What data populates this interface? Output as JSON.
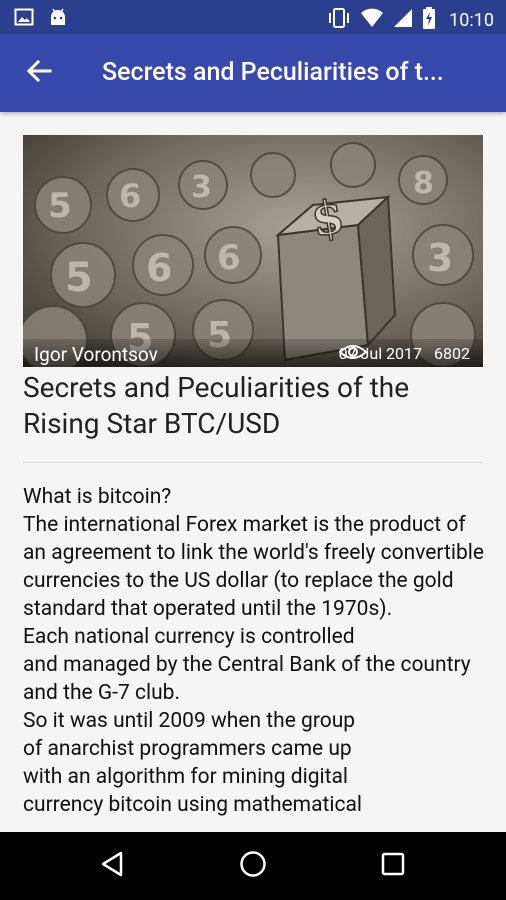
{
  "status_bar": {
    "time": "10:10"
  },
  "app_bar": {
    "title": "Secrets and Peculiarities of t..."
  },
  "article": {
    "author": "Igor Vorontsov",
    "date": "07 Jul 2017",
    "views": "6802",
    "title": "Secrets and Peculiarities of the Rising Star BTC/USD",
    "body": "What is bitcoin?\n  The international Forex market is the product of an agreement to link the world's freely convertible currencies to the US dollar (to replace the gold standard that operated until the 1970s).\n  Each national currency is controlled\nand managed by the Central Bank of the country and the G-7 club.\n  So it was until 2009 when the group\nof anarchist programmers came up\nwith an algorithm for mining digital\ncurrency bitcoin using mathematical"
  },
  "icons": {
    "status": [
      "gallery-icon",
      "android-icon",
      "vibrate-icon",
      "wifi-icon",
      "signal-icon",
      "battery-icon"
    ],
    "app_bar": [
      "back-arrow-icon"
    ],
    "article": [
      "eye-icon"
    ],
    "nav": [
      "back-triangle-icon",
      "home-circle-icon",
      "recents-square-icon"
    ]
  },
  "colors": {
    "status_bar": "#2c3e8e",
    "app_bar": "#3949ab",
    "nav_bar": "#000000"
  }
}
